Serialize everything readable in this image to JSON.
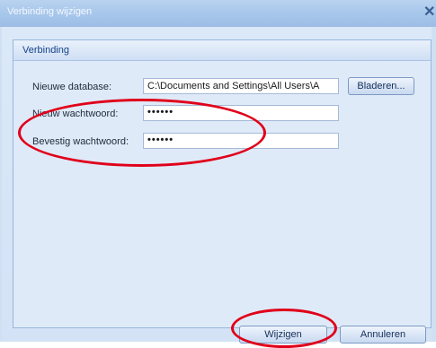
{
  "window": {
    "title": "Verbinding wijzigen",
    "close_glyph": "✕"
  },
  "group": {
    "title": "Verbinding"
  },
  "fields": {
    "database": {
      "label": "Nieuwe database:",
      "value": "C:\\Documents and Settings\\All Users\\A"
    },
    "password": {
      "label": "Nieuw wachtwoord:",
      "value": "••••••"
    },
    "confirm": {
      "label": "Bevestig wachtwoord:",
      "value": "••••••"
    }
  },
  "buttons": {
    "browse": "Bladeren...",
    "change": "Wijzigen",
    "cancel": "Annuleren"
  },
  "annotation_color": "#e0001a"
}
